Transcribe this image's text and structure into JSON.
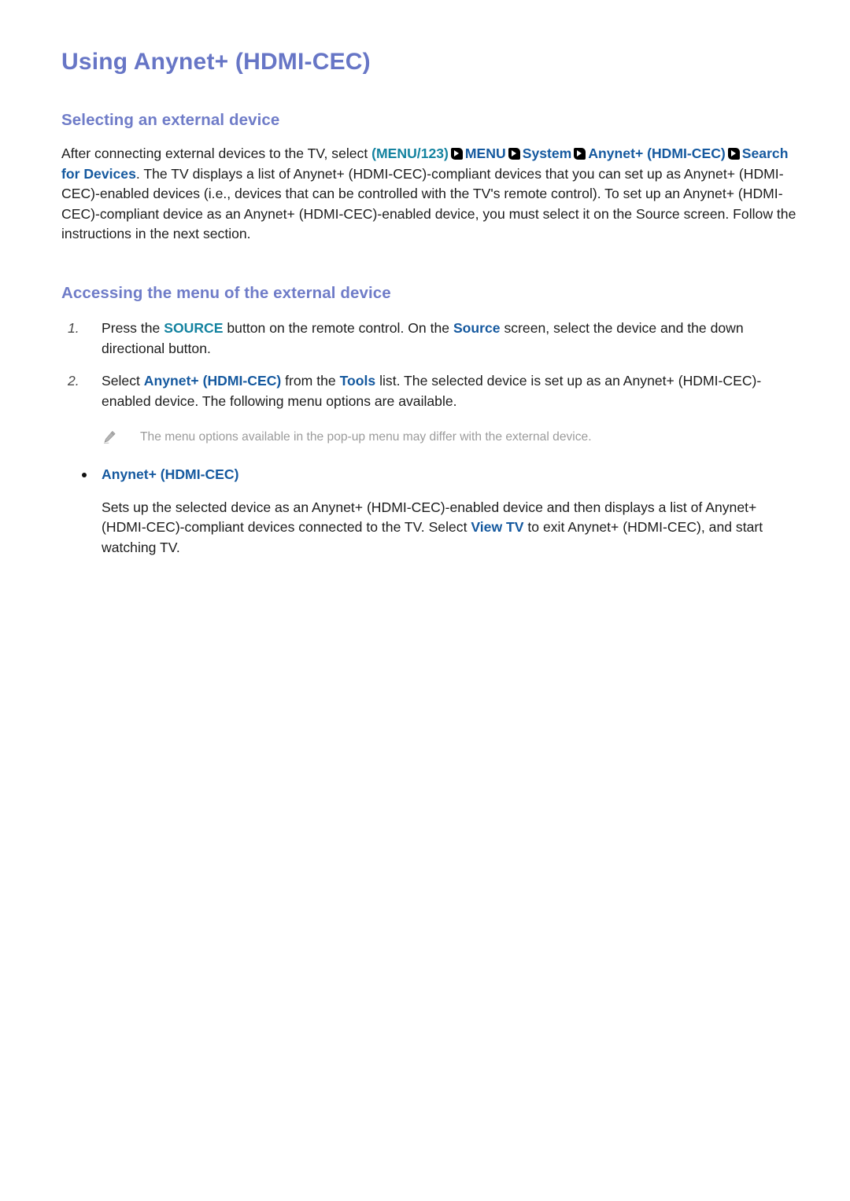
{
  "document": {
    "title": "Using Anynet+ (HDMI-CEC)",
    "colors": {
      "heading": "#6776c6",
      "subheading": "#6f7cc8",
      "remote_button_token": "#1483a0",
      "menu_token": "#15599f",
      "body_text": "#1c1c1c",
      "note_text": "#9b9b9b",
      "background": "#ffffff"
    }
  },
  "sections": {
    "selecting": {
      "heading": "Selecting an external device",
      "paragraph": {
        "p1": "After connecting external devices to the TV, select ",
        "tok_menu123": "(MENU/123)",
        "arrow_icon_1": "arrow-right-icon",
        "tok_menu": "MENU",
        "arrow_icon_2": "arrow-right-icon",
        "tok_system": "System",
        "arrow_icon_3": "arrow-right-icon",
        "tok_anynet": "Anynet+ (HDMI-CEC)",
        "arrow_icon_4": "arrow-right-icon",
        "tok_search": "Search for Devices",
        "p2": ". The TV displays a list of Anynet+ (HDMI-CEC)-compliant devices that you can set up as Anynet+ (HDMI-CEC)-enabled devices (i.e., devices that can be controlled with the TV's remote control). To set up an Anynet+ (HDMI-CEC)-compliant device as an Anynet+ (HDMI-CEC)-enabled device, you must select it on the Source screen. Follow the instructions in the next section."
      }
    },
    "accessing": {
      "heading": "Accessing the menu of the external device",
      "steps": [
        {
          "number": "1.",
          "pre": "Press the ",
          "tok_source_button": "SOURCE",
          "mid": " button on the remote control. On the ",
          "tok_source_screen": "Source",
          "post": " screen, select the device and the down directional button."
        },
        {
          "number": "2.",
          "pre": "Select ",
          "tok_anynet": "Anynet+ (HDMI-CEC)",
          "mid": " from the ",
          "tok_tools": "Tools",
          "post": " list. The selected device is set up as an Anynet+ (HDMI-CEC)-enabled device. The following menu options are available."
        }
      ],
      "note": {
        "icon": "pencil-icon",
        "text": "The menu options available in the pop-up menu may differ with the external device."
      },
      "bullet": {
        "icon": "bullet-dot-icon",
        "label": "Anynet+ (HDMI-CEC)",
        "body_pre": "Sets up the selected device as an Anynet+ (HDMI-CEC)-enabled device and then displays a list of Anynet+ (HDMI-CEC)-compliant devices connected to the TV. Select ",
        "tok_view_tv": "View TV",
        "body_post": " to exit Anynet+ (HDMI-CEC), and start watching TV."
      }
    }
  }
}
